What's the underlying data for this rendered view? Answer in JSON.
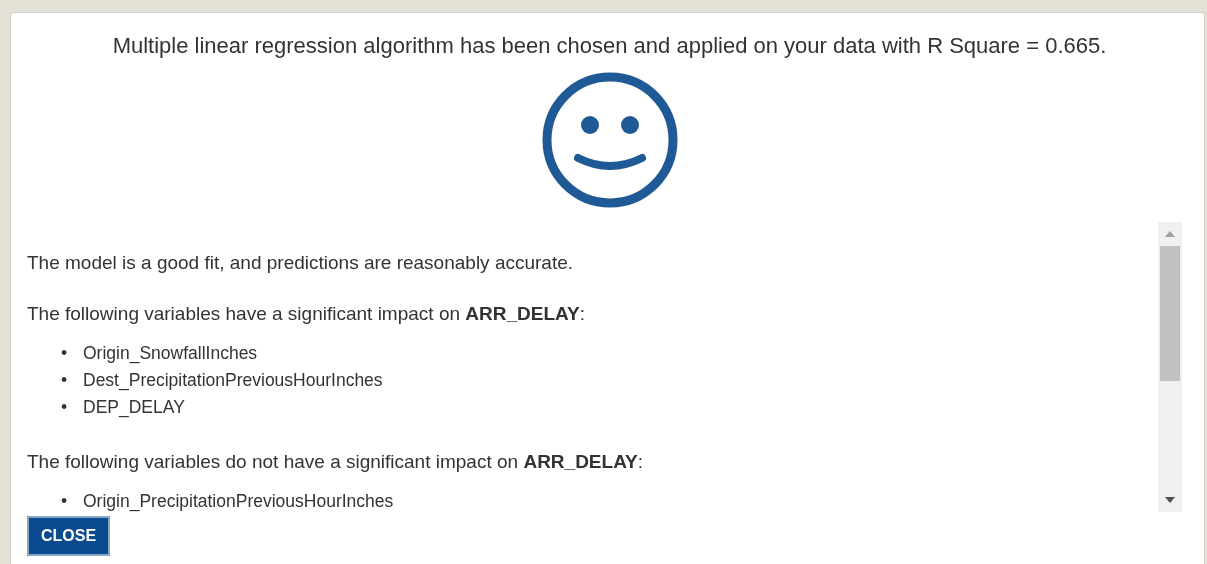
{
  "dialog": {
    "title": "Multiple linear regression algorithm has been chosen and applied on your data with R Square = 0.665.",
    "content": [
      {
        "kind": "paragraph",
        "text": "The model is a good fit, and predictions are reasonably accurate."
      },
      {
        "kind": "paragraph",
        "text": "The following variables have a significant impact on **ARR_DELAY**:"
      },
      {
        "kind": "list",
        "items": [
          {
            "marker": "•",
            "text": "Origin_SnowfallInches"
          },
          {
            "marker": "•",
            "text": "Dest_PrecipitationPreviousHourInches"
          },
          {
            "marker": "•",
            "text": "DEP_DELAY"
          }
        ]
      },
      {
        "kind": "paragraph",
        "text": "The following variables do not have a significant impact on **ARR_DELAY**:"
      },
      {
        "kind": "list",
        "items": [
          {
            "marker": "•",
            "text": "Origin_PrecipitationPreviousHourInches"
          }
        ]
      }
    ],
    "buttons": [
      {
        "label": "CLOSE"
      }
    ]
  }
}
